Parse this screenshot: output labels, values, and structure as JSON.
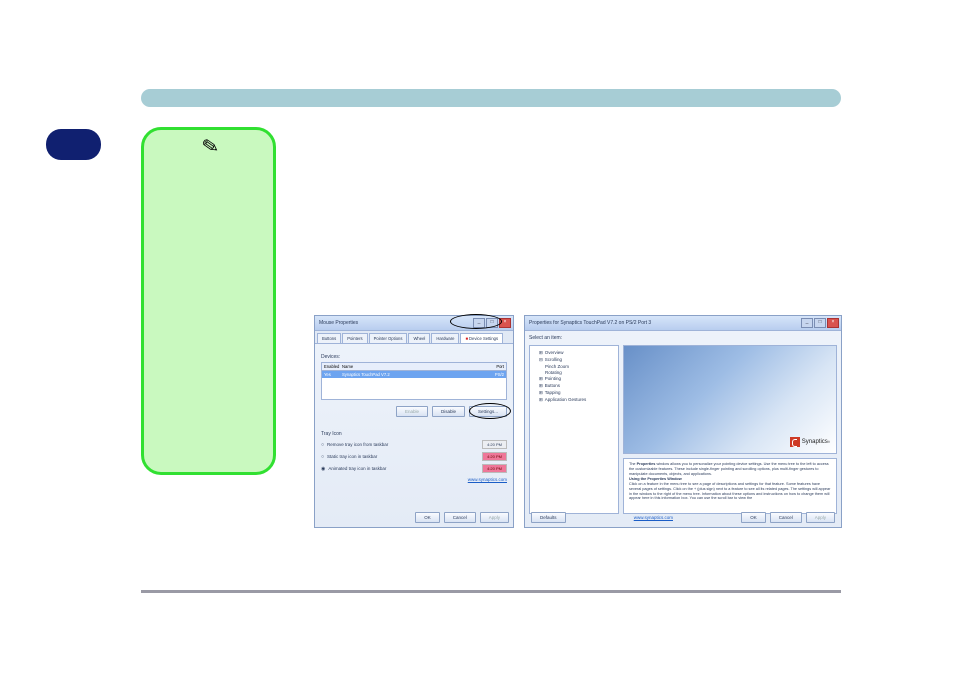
{
  "mouseProps": {
    "title": "Mouse Properties",
    "tabs": [
      "Buttons",
      "Pointers",
      "Pointer Options",
      "Wheel",
      "Hardware",
      "Device Settings"
    ],
    "redIconTab": "Device Settings",
    "devicesLabel": "Devices:",
    "columns": {
      "enabled": "Enabled",
      "name": "Name",
      "port": "Port"
    },
    "deviceRow": {
      "enabled": "Yes",
      "name": "Synaptics TouchPad V7.2",
      "port": "PS/2"
    },
    "buttons": {
      "enable": "Enable",
      "disable": "Disable",
      "settings": "Settings..."
    },
    "trayLabel": "Tray Icon",
    "trayOptions": {
      "remove": "Remove tray icon from taskbar",
      "static": "Static tray icon in taskbar",
      "animated": "Animated tray icon in taskbar"
    },
    "times": {
      "t1": "4:20 PM",
      "t2": "4:20 PM",
      "t3": "4:20 PM"
    },
    "url": "www.synaptics.com",
    "okLabel": "OK",
    "cancelLabel": "Cancel",
    "applyLabel": "Apply"
  },
  "synProps": {
    "title": "Properties for Synaptics TouchPad V7.2 on PS/2 Port 3",
    "selectLabel": "Select an item:",
    "tree": {
      "overview": "Overview",
      "scrolling": "Scrolling",
      "pinchZoom": "Pinch Zoom",
      "rotating": "Rotating",
      "pointing": "Pointing",
      "buttons": "Buttons",
      "tapping": "Tapping",
      "appGestures": "Application Gestures"
    },
    "logoName": "Synaptics",
    "desc": {
      "p1a": "The ",
      "p1b": "Properties",
      "p1c": " window allows you to personalize your pointing device settings. Use the menu tree to the left to access the customizable features. These include single-finger pointing and scrolling options, plus multi-finger gestures to manipulate documents, objects, and applications.",
      "h2": "Using the Properties Window",
      "p2": "Click on a feature in the menu tree to see a page of descriptions and settings for that feature. Some features have several pages of settings. Click on the + (plus sign) next to a feature to see all its related pages. The settings will appear in the window to the right of the menu tree. Information about these options and instructions on how to change them will appear here in this information box. You can use the scroll bar to view the"
    },
    "defaultsLabel": "Defaults",
    "url": "www.synaptics.com",
    "okLabel": "OK",
    "cancelLabel": "Cancel",
    "applyLabel": "Apply"
  }
}
